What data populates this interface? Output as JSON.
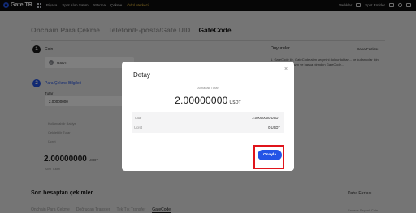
{
  "topbar": {
    "logo": "Gate.TR",
    "nav": [
      "Piyasa",
      "Spot Alım Satım",
      "Yatırma",
      "Çekme",
      "Ödül Merkezi"
    ],
    "right": [
      "Varlıklar",
      "Spot Emirler"
    ]
  },
  "tabs": [
    "Onchain Para Çekme",
    "Telefon/E-posta/Gate UID",
    "GateCode"
  ],
  "steps": {
    "coin_num": "1",
    "coin_label": "Coin",
    "coin_value": "USDT",
    "transfer_num": "2",
    "transfer_label": "Para Çekme Bilgileri",
    "amount_label": "Tutar",
    "amount_value": "2.00000000",
    "available_label": "Kullanılabilir Bakiye",
    "limit_label": "Çekilebilir Tutar",
    "fee_label": "Ücret"
  },
  "received": {
    "amount": "2.00000000",
    "unit": "USDT",
    "label": "Alım Tutarı"
  },
  "aside": {
    "title": "Duyurular",
    "more": "Daha Fazlası",
    "text": "1. GateCode ile, GateCode alım seçimini doldurduktan... ve kullanıcılar için gönderim yapmayın ve başka birinden GateCode..."
  },
  "history": {
    "title": "Son hesaptan çekimler",
    "more": "Daha Fazlası",
    "tabs": [
      "Onchain Para Çekme",
      "Doğrudan Transfer",
      "Tek Tık Transfer",
      "GateCode"
    ],
    "right": "Sadece Seçenli Coin"
  },
  "modal": {
    "title": "Detay",
    "close": "×",
    "received_label": "Alınacak Tutar",
    "received_value": "2.00000000",
    "received_unit": "USDT",
    "rows": [
      {
        "key": "Tutar",
        "value": "2.00000000 USDT"
      },
      {
        "key": "Ücret",
        "value": "0 USDT"
      }
    ],
    "confirm": "Onayla"
  }
}
